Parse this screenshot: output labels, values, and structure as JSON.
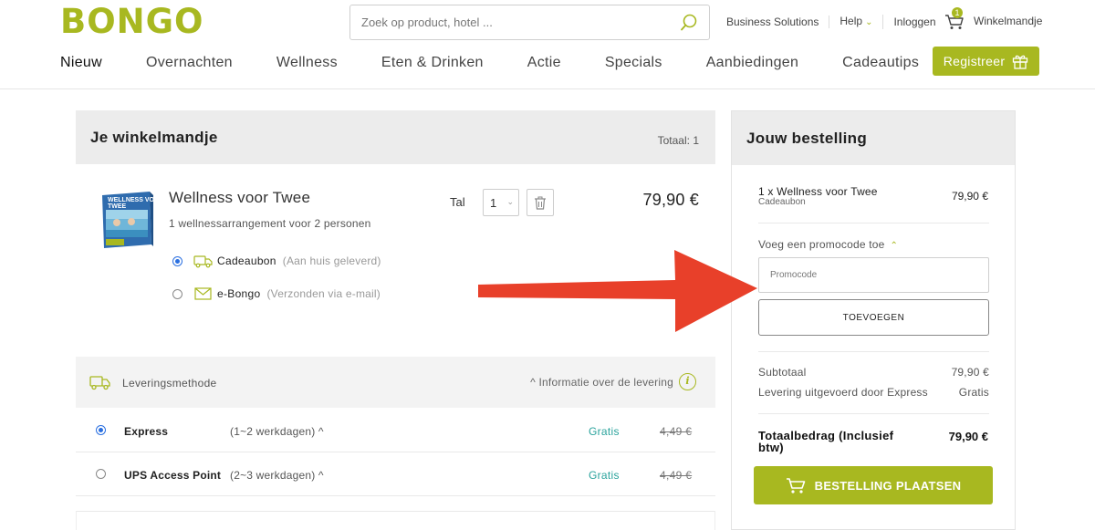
{
  "brand": {
    "logo": "BONGO",
    "accent": "#a8b820",
    "teal": "#2aa39c",
    "arrow": "#e8402a"
  },
  "search": {
    "placeholder": "Zoek op product, hotel ..."
  },
  "toplinks": {
    "business": "Business Solutions",
    "help": "Help",
    "login": "Inloggen",
    "cart_label": "Winkelmandje",
    "cart_count": "1"
  },
  "nav": [
    "Nieuw",
    "Overnachten",
    "Wellness",
    "Eten & Drinken",
    "Actie",
    "Specials",
    "Aanbiedingen",
    "Cadeautips"
  ],
  "register_label": "Registreer",
  "cart_panel": {
    "title": "Je winkelmandje",
    "totaal": "Totaal: 1",
    "product": {
      "image_title": "Wellness voor Twee",
      "name": "Wellness voor Twee",
      "subtitle": "1 wellnessarrangement voor 2 personen",
      "option1_label": "Cadeaubon",
      "option1_note": "(Aan huis geleverd)",
      "option2_label": "e-Bongo",
      "option2_note": "(Verzonden via e-mail)",
      "qty_label": "Tal",
      "qty": "1",
      "price": "79,90 €"
    }
  },
  "delivery": {
    "title": "Leveringsmethode",
    "info": "^ Informatie over de levering",
    "methods": [
      {
        "name": "Express",
        "days": "(1~2 werkdagen) ^",
        "price": "Gratis",
        "old": "4,49 €",
        "selected": true
      },
      {
        "name": "UPS Access Point",
        "days": "(2~3 werkdagen) ^",
        "price": "Gratis",
        "old": "4,49 €",
        "selected": false
      }
    ]
  },
  "order_panel": {
    "title": "Jouw bestelling",
    "line": "1 x Wellness voor Twee",
    "line_type": "Cadeaubon",
    "line_price": "79,90 €",
    "promo_toggle": "Voeg een promocode toe",
    "promo_placeholder": "Promocode",
    "promo_button": "TOEVOEGEN",
    "subtotal_label": "Subtotaal",
    "subtotal_value": "79,90 €",
    "shipping_label": "Levering uitgevoerd door Express",
    "shipping_value": "Gratis",
    "total_label": "Totaalbedrag (Inclusief btw)",
    "total_value": "79,90 €",
    "order_button": "BESTELLING PLAATSEN"
  }
}
